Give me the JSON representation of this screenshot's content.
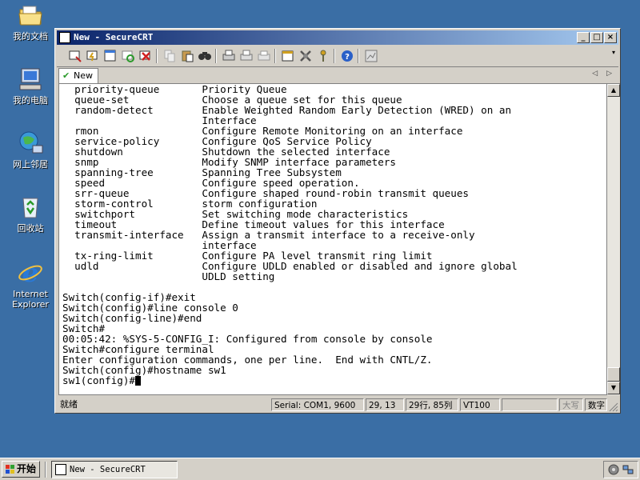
{
  "desktop": {
    "icons": [
      {
        "label": "我的文档",
        "icon": "folder-icon"
      },
      {
        "label": "我的电脑",
        "icon": "computer-icon"
      },
      {
        "label": "网上邻居",
        "icon": "network-icon"
      },
      {
        "label": "回收站",
        "icon": "recycle-bin-icon"
      },
      {
        "label": "Internet Explorer",
        "icon": "ie-icon"
      }
    ]
  },
  "window": {
    "title": "New - SecureCRT",
    "tab": {
      "label": "New"
    }
  },
  "terminal": {
    "lines": [
      "  priority-queue       Priority Queue",
      "  queue-set            Choose a queue set for this queue",
      "  random-detect        Enable Weighted Random Early Detection (WRED) on an",
      "                       Interface",
      "  rmon                 Configure Remote Monitoring on an interface",
      "  service-policy       Configure QoS Service Policy",
      "  shutdown             Shutdown the selected interface",
      "  snmp                 Modify SNMP interface parameters",
      "  spanning-tree        Spanning Tree Subsystem",
      "  speed                Configure speed operation.",
      "  srr-queue            Configure shaped round-robin transmit queues",
      "  storm-control        storm configuration",
      "  switchport           Set switching mode characteristics",
      "  timeout              Define timeout values for this interface",
      "  transmit-interface   Assign a transmit interface to a receive-only",
      "                       interface",
      "  tx-ring-limit        Configure PA level transmit ring limit",
      "  udld                 Configure UDLD enabled or disabled and ignore global",
      "                       UDLD setting",
      "",
      "Switch(config-if)#exit",
      "Switch(config)#line console 0",
      "Switch(config-line)#end",
      "Switch#",
      "00:05:42: %SYS-5-CONFIG_I: Configured from console by console",
      "Switch#configure terminal",
      "Enter configuration commands, one per line.  End with CNTL/Z.",
      "Switch(config)#hostname sw1"
    ],
    "prompt": "sw1(config)#"
  },
  "status": {
    "ready": "就绪",
    "connection": "Serial: COM1, 9600",
    "cursor": "29, 13",
    "size": "29行, 85列",
    "emulation": "VT100",
    "blank": "",
    "caps": "大写",
    "num": "数字"
  },
  "taskbar": {
    "start": "开始",
    "task": "New - SecureCRT"
  }
}
